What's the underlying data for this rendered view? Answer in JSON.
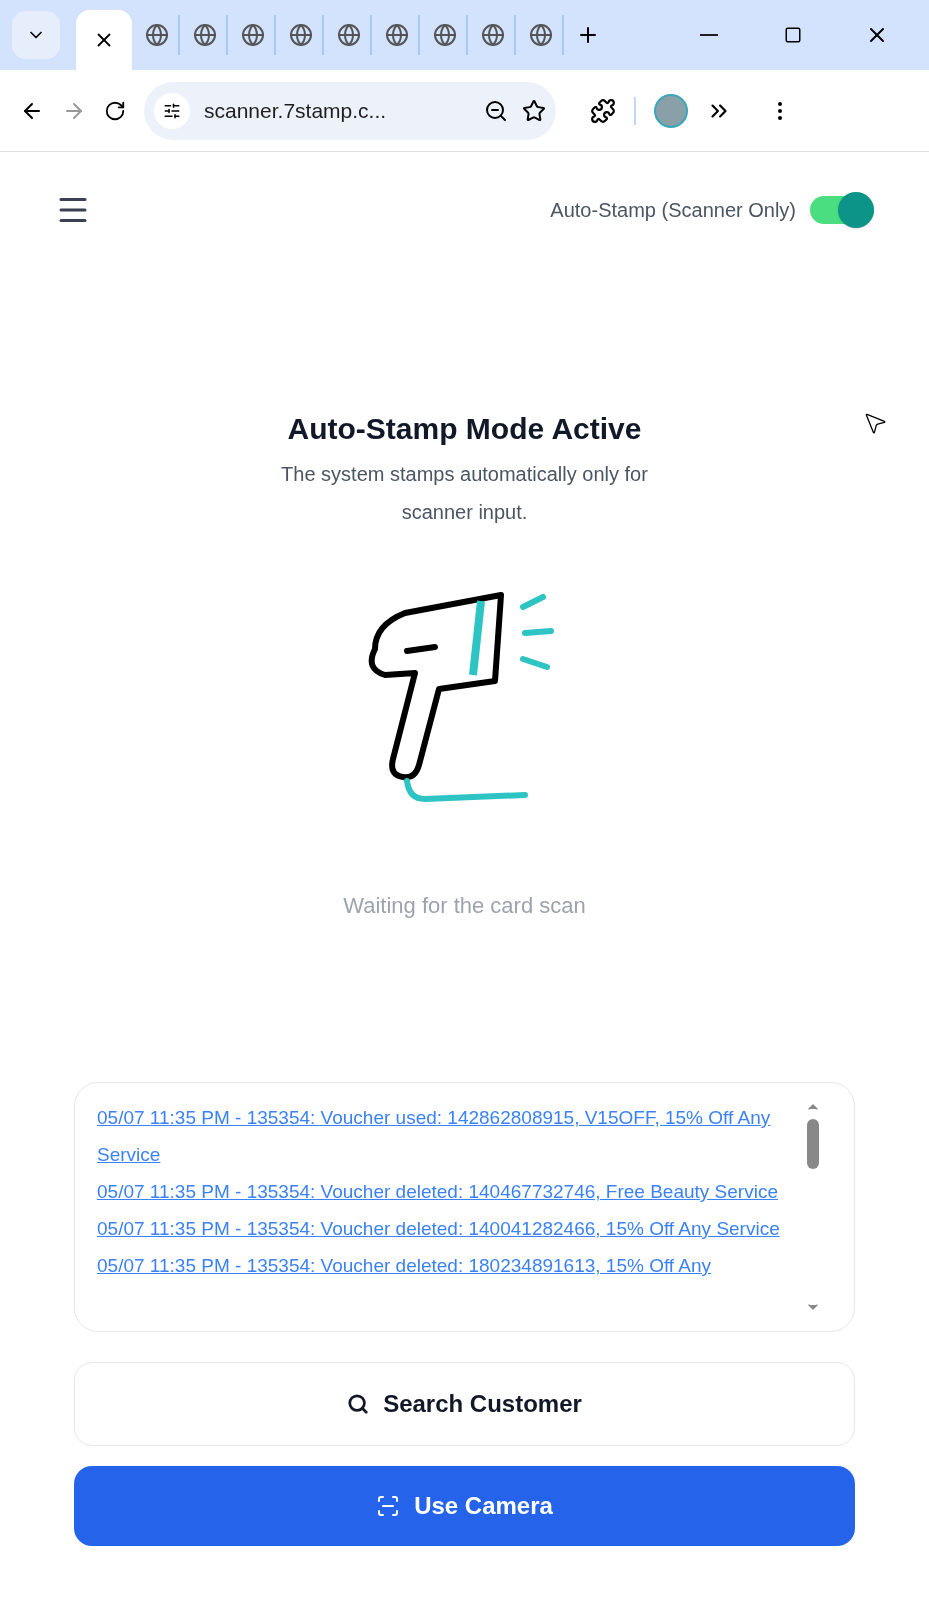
{
  "browser": {
    "tabs": [
      {
        "selected": true
      },
      {
        "selected": false
      },
      {
        "selected": false
      },
      {
        "selected": false
      },
      {
        "selected": false
      },
      {
        "selected": false
      },
      {
        "selected": false
      },
      {
        "selected": false
      },
      {
        "selected": false
      },
      {
        "selected": false
      }
    ],
    "url": "scanner.7stamp.c..."
  },
  "header": {
    "toggle": {
      "label": "Auto-Stamp (Scanner Only)",
      "on": true
    }
  },
  "status": {
    "title": "Auto-Stamp Mode Active",
    "description": "The system stamps automatically only for scanner input.",
    "waiting": "Waiting for the card scan"
  },
  "log": [
    {
      "text": "05/07 11:35 PM - 135354: Voucher used: 142862808915, V15OFF, 15% Off Any Service"
    },
    {
      "text": "05/07 11:35 PM - 135354: Voucher deleted: 140467732746, Free Beauty Service"
    },
    {
      "text": "05/07 11:35 PM - 135354: Voucher deleted: 140041282466, 15% Off Any Service"
    },
    {
      "text": "05/07 11:35 PM - 135354: Voucher deleted: 180234891613, 15% Off Any"
    }
  ],
  "buttons": [
    {
      "kind": "search",
      "label": "Search Customer"
    },
    {
      "kind": "camera",
      "label": "Use Camera"
    }
  ]
}
